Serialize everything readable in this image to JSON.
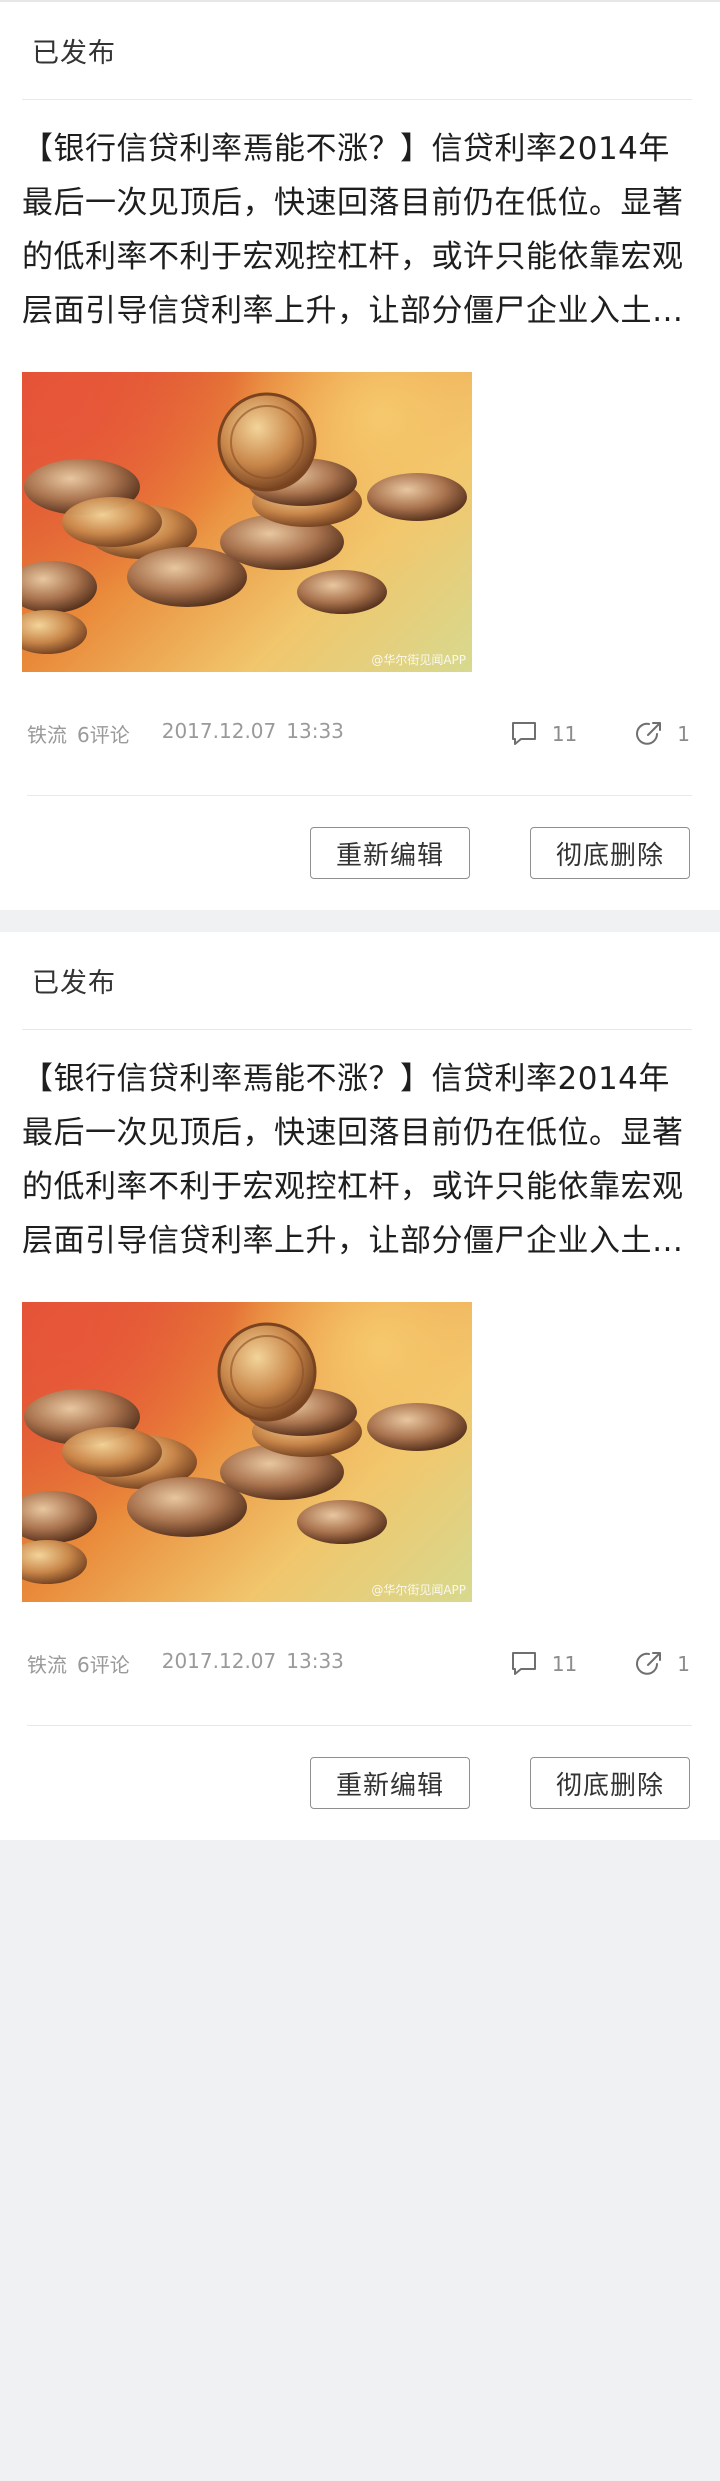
{
  "posts": [
    {
      "status": "已发布",
      "content": "【银行信贷利率焉能不涨？】信贷利率2014年最后一次见顶后，快速回落目前仍在低位。显著的低利率不利于宏观控杠杆，或许只能依靠宏观层面引导信贷利率上升，让部分僵尸企业入土…",
      "image_icon": "coins-photo",
      "watermark": "@华尔街见闻APP",
      "author": "铁流",
      "comments_label": "6评论",
      "date": "2017.12.07",
      "time": "13:33",
      "comment_count": "11",
      "share_count": "1",
      "edit_label": "重新编辑",
      "delete_label": "彻底删除"
    },
    {
      "status": "已发布",
      "content": "【银行信贷利率焉能不涨？】信贷利率2014年最后一次见顶后，快速回落目前仍在低位。显著的低利率不利于宏观控杠杆，或许只能依靠宏观层面引导信贷利率上升，让部分僵尸企业入土…",
      "image_icon": "coins-photo",
      "watermark": "@华尔街见闻APP",
      "author": "铁流",
      "comments_label": "6评论",
      "date": "2017.12.07",
      "time": "13:33",
      "comment_count": "11",
      "share_count": "1",
      "edit_label": "重新编辑",
      "delete_label": "彻底删除"
    }
  ]
}
